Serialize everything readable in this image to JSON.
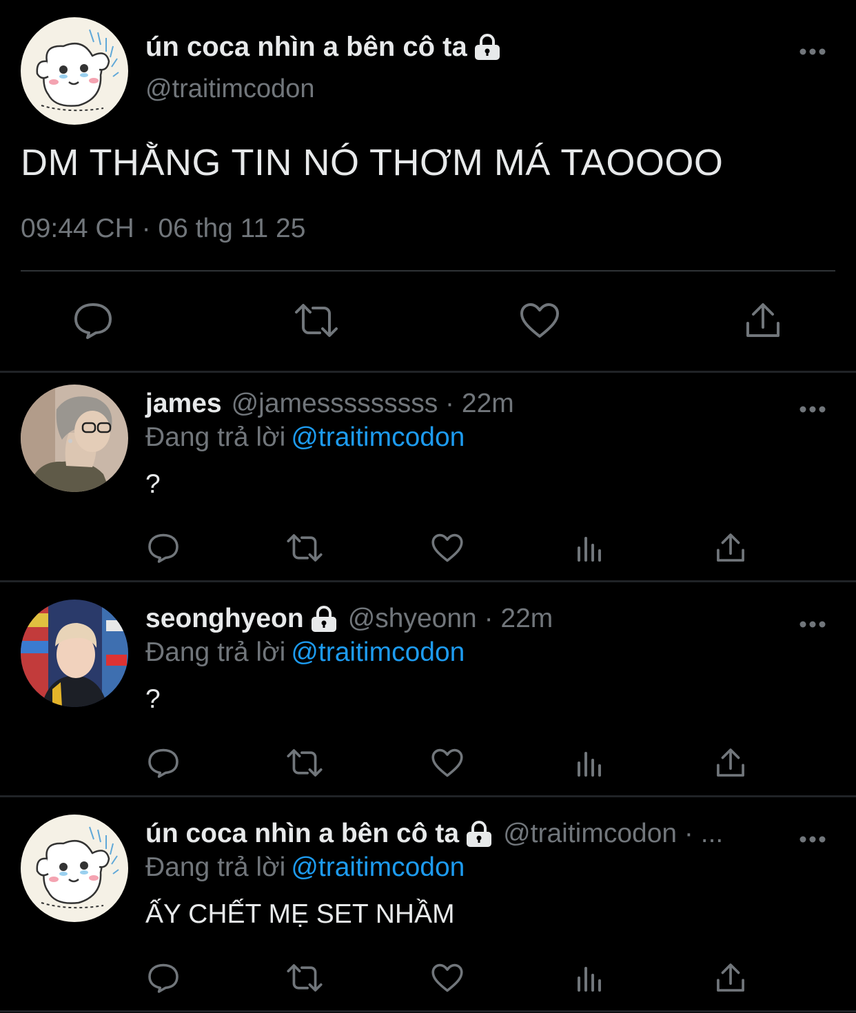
{
  "main_tweet": {
    "name": "ún coca nhìn a bên cô ta",
    "handle": "@traitimcodon",
    "text": "DM THẰNG TIN NÓ THƠM MÁ TAOOOO",
    "timestamp": "09:44 CH · 06 thg 11 25"
  },
  "replies": [
    {
      "name": "james",
      "handle": "@jamesssssssss · 22m",
      "reply_label": "Đang trả lời",
      "reply_mention": "@traitimcodon",
      "text": "?"
    },
    {
      "name": "seonghyeon",
      "handle": "@shyeonn · 22m",
      "reply_label": "Đang trả lời",
      "reply_mention": "@traitimcodon",
      "text": "?"
    },
    {
      "name": "ún coca nhìn a bên cô ta",
      "handle": "@traitimcodon · ...",
      "reply_label": "Đang trả lời",
      "reply_mention": "@traitimcodon",
      "text": "ẤY CHẾT MẸ SET NHẦM"
    }
  ],
  "colors": {
    "background": "#000000",
    "text_primary": "#e7e9ea",
    "text_secondary": "#71767b",
    "accent": "#1d9bf0",
    "divider": "#2f3336"
  },
  "icons": [
    "lock-icon",
    "more-icon",
    "reply-icon",
    "retweet-icon",
    "like-icon",
    "views-icon",
    "share-icon"
  ]
}
